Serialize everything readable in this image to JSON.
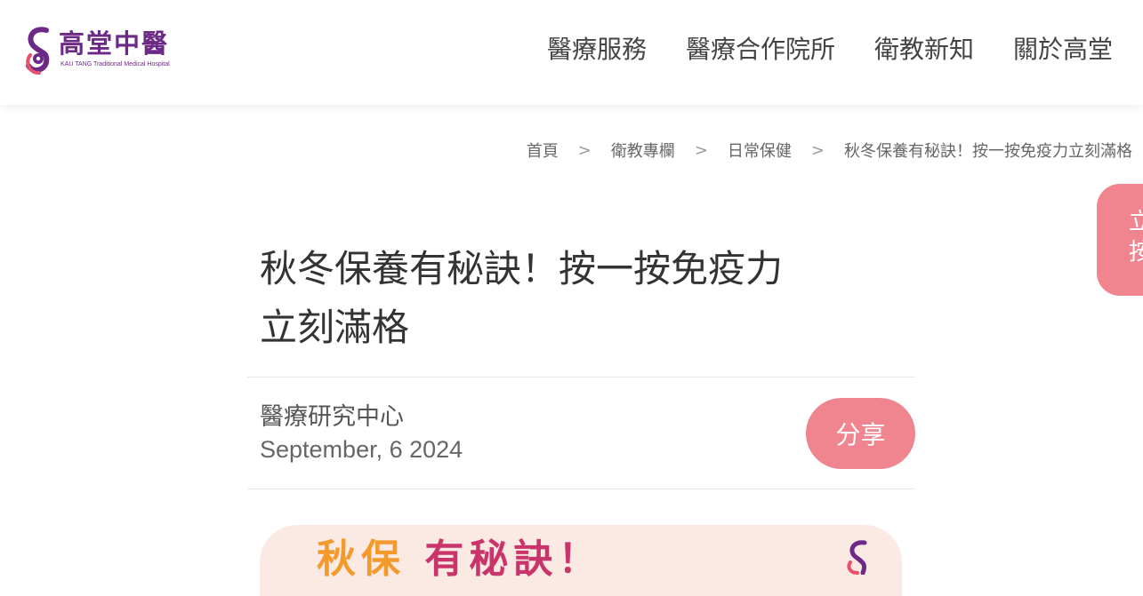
{
  "brand": {
    "name": "高堂中醫",
    "tagline": "KAU TANG Traditional Medical Hospital",
    "primary_color": "#6c2a86",
    "accent_color": "#f0858f"
  },
  "nav": {
    "items": [
      "醫療服務",
      "醫療合作院所",
      "衛教新知",
      "關於高堂"
    ]
  },
  "breadcrumb": {
    "items": [
      "首頁",
      "衛教專欄",
      "日常保健",
      "秋冬保養有秘訣！按一按免疫力立刻滿格"
    ],
    "separator": ">"
  },
  "side_cta": {
    "line1": "立",
    "line2": "按"
  },
  "article": {
    "title_line1": "秋冬保養有秘訣！按一按免疫力",
    "title_line2": "立刻滿格",
    "author": "醫療研究中心",
    "date": "September, 6 2024",
    "share_label": "分享"
  },
  "hero": {
    "visible_text_part1": "秋保",
    "visible_text_part2": "有秘訣！"
  }
}
